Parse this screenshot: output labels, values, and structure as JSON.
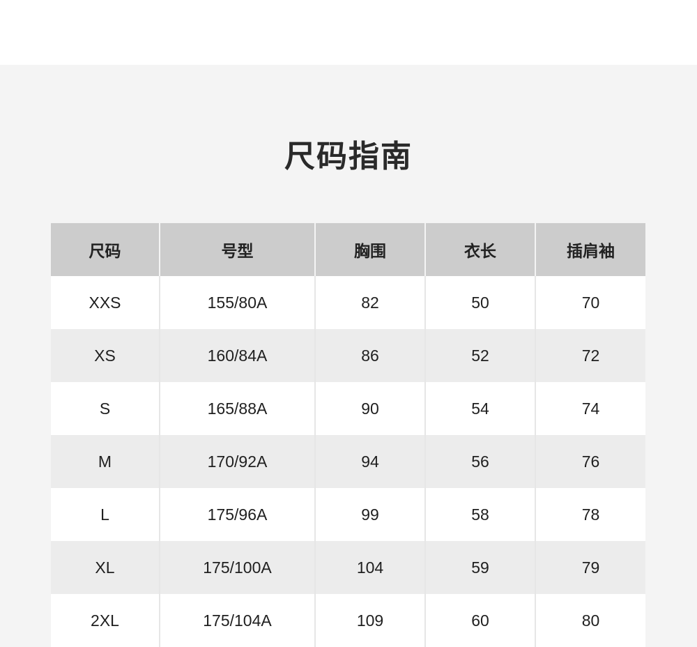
{
  "page": {
    "title": "尺码指南"
  },
  "table": {
    "headers": [
      "尺码",
      "号型",
      "胸围",
      "衣长",
      "插肩袖"
    ],
    "rows": [
      [
        "XXS",
        "155/80A",
        "82",
        "50",
        "70"
      ],
      [
        "XS",
        "160/84A",
        "86",
        "52",
        "72"
      ],
      [
        "S",
        "165/88A",
        "90",
        "54",
        "74"
      ],
      [
        "M",
        "170/92A",
        "94",
        "56",
        "76"
      ],
      [
        "L",
        "175/96A",
        "99",
        "58",
        "78"
      ],
      [
        "XL",
        "175/100A",
        "104",
        "59",
        "79"
      ],
      [
        "2XL",
        "175/104A",
        "109",
        "60",
        "80"
      ]
    ]
  },
  "colors": {
    "header_bg": "#cccccc",
    "panel_bg": "#f4f4f4",
    "row_odd": "#ffffff",
    "row_even": "#ececec"
  }
}
